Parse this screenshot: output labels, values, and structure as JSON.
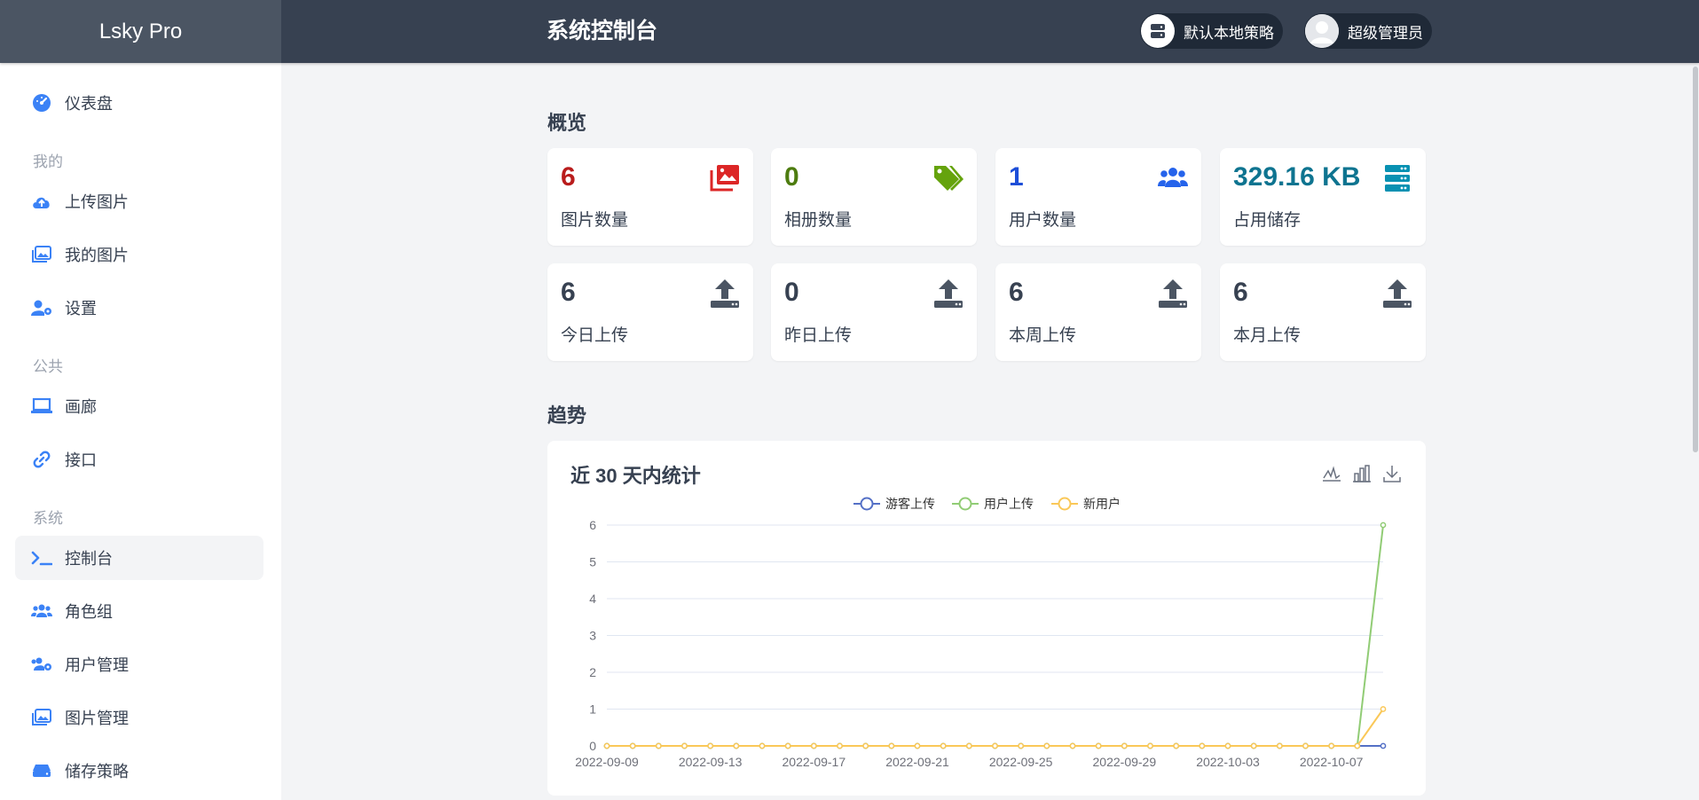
{
  "brand": "Lsky Pro",
  "header": {
    "title": "系统控制台",
    "strategy_label": "默认本地策略",
    "user_label": "超级管理员"
  },
  "sidebar": {
    "dashboard": "仪表盘",
    "group_mine": "我的",
    "upload": "上传图片",
    "my_images": "我的图片",
    "settings": "设置",
    "group_public": "公共",
    "gallery": "画廊",
    "api": "接口",
    "group_system": "系统",
    "console": "控制台",
    "roles": "角色组",
    "users": "用户管理",
    "images": "图片管理",
    "storage": "储存策略"
  },
  "overview": {
    "title": "概览",
    "cards": [
      {
        "value": "6",
        "label": "图片数量",
        "color": "#b91c1c",
        "icon": "images-icon"
      },
      {
        "value": "0",
        "label": "相册数量",
        "color": "#4d7c0f",
        "icon": "tags-icon"
      },
      {
        "value": "1",
        "label": "用户数量",
        "color": "#1d4ed8",
        "icon": "users-icon"
      },
      {
        "value": "329.16 KB",
        "label": "占用储存",
        "color": "#0e7490",
        "icon": "server-icon"
      },
      {
        "value": "6",
        "label": "今日上传",
        "color": "#374151",
        "icon": "upload-icon"
      },
      {
        "value": "0",
        "label": "昨日上传",
        "color": "#374151",
        "icon": "upload-icon"
      },
      {
        "value": "6",
        "label": "本周上传",
        "color": "#374151",
        "icon": "upload-icon"
      },
      {
        "value": "6",
        "label": "本月上传",
        "color": "#374151",
        "icon": "upload-icon"
      }
    ]
  },
  "trend": {
    "title": "趋势",
    "chart_title": "近 30 天内统计"
  },
  "chart_data": {
    "type": "line",
    "title": "近 30 天内统计",
    "x": [
      "2022-09-09",
      "2022-09-10",
      "2022-09-11",
      "2022-09-12",
      "2022-09-13",
      "2022-09-14",
      "2022-09-15",
      "2022-09-16",
      "2022-09-17",
      "2022-09-18",
      "2022-09-19",
      "2022-09-20",
      "2022-09-21",
      "2022-09-22",
      "2022-09-23",
      "2022-09-24",
      "2022-09-25",
      "2022-09-26",
      "2022-09-27",
      "2022-09-28",
      "2022-09-29",
      "2022-09-30",
      "2022-10-01",
      "2022-10-02",
      "2022-10-03",
      "2022-10-04",
      "2022-10-05",
      "2022-10-06",
      "2022-10-07",
      "2022-10-08",
      "2022-10-09"
    ],
    "x_tick_labels": [
      "2022-09-09",
      "2022-09-13",
      "2022-09-17",
      "2022-09-21",
      "2022-09-25",
      "2022-09-29",
      "2022-10-03",
      "2022-10-07"
    ],
    "series": [
      {
        "name": "游客上传",
        "color": "#5470c6",
        "values": [
          0,
          0,
          0,
          0,
          0,
          0,
          0,
          0,
          0,
          0,
          0,
          0,
          0,
          0,
          0,
          0,
          0,
          0,
          0,
          0,
          0,
          0,
          0,
          0,
          0,
          0,
          0,
          0,
          0,
          0,
          0
        ]
      },
      {
        "name": "用户上传",
        "color": "#91cc75",
        "values": [
          0,
          0,
          0,
          0,
          0,
          0,
          0,
          0,
          0,
          0,
          0,
          0,
          0,
          0,
          0,
          0,
          0,
          0,
          0,
          0,
          0,
          0,
          0,
          0,
          0,
          0,
          0,
          0,
          0,
          0,
          6
        ]
      },
      {
        "name": "新用户",
        "color": "#fac858",
        "values": [
          0,
          0,
          0,
          0,
          0,
          0,
          0,
          0,
          0,
          0,
          0,
          0,
          0,
          0,
          0,
          0,
          0,
          0,
          0,
          0,
          0,
          0,
          0,
          0,
          0,
          0,
          0,
          0,
          0,
          0,
          1
        ]
      }
    ],
    "ylim": [
      0,
      6
    ],
    "y_ticks": [
      0,
      1,
      2,
      3,
      4,
      5,
      6
    ],
    "legend": "top-center",
    "grid": true
  }
}
